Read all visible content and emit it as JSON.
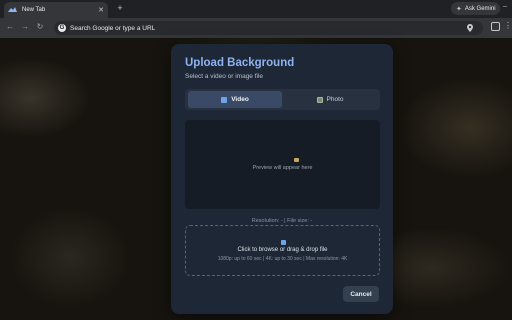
{
  "browser": {
    "tab": {
      "title": "New Tab"
    },
    "new_tab_symbol": "+",
    "ask_gemini_label": "Ask Gemini",
    "omnibox": {
      "placeholder": "Search Google or type a URL",
      "g_letter": "G"
    }
  },
  "dialog": {
    "title": "Upload Background",
    "subtitle": "Select a video or image file",
    "tabs": [
      {
        "label": "Video",
        "selected": true,
        "icon": "video-icon"
      },
      {
        "label": "Photo",
        "selected": false,
        "icon": "photo-icon"
      }
    ],
    "preview_placeholder": "Preview will appear here",
    "resolution_label": "Resolution: - | File size: -",
    "dropzone": {
      "main_text": "Click to browse or drag & drop file",
      "limits_text": "1080p: up to 60 sec | 4K: up to 30 sec | Max resolution: 4K"
    },
    "cancel_label": "Cancel"
  },
  "colors": {
    "accent": "#8fb2f2",
    "dialog_bg": "#1e2735",
    "selected_tab": "#3a4a66"
  }
}
